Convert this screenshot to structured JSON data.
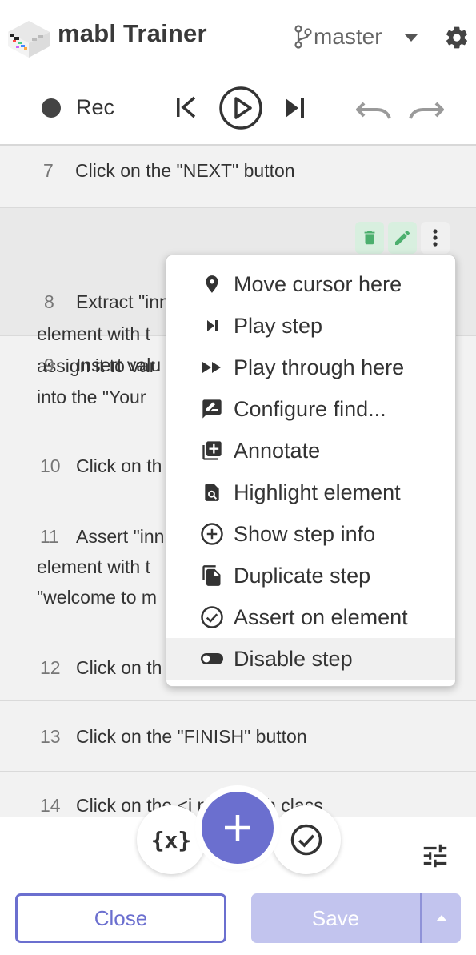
{
  "header": {
    "app_title": "mabl Trainer",
    "branch": "master",
    "branch_icon": "git-branch-icon",
    "settings_icon": "gear-icon"
  },
  "recorder": {
    "rec_label": "Rec",
    "controls": [
      "skip-back-icon",
      "play-icon",
      "skip-forward-icon",
      "undo-icon",
      "redo-icon"
    ]
  },
  "steps": [
    {
      "num": "7",
      "text": "Click on the \"NEXT\" button"
    },
    {
      "num": "8",
      "line1": "Extract \"innerText\" from the <h",
      "line2": "element with t",
      "line3": "assign it to var"
    },
    {
      "num": "9",
      "line1": "Insert valu",
      "line2": "into the \"Your"
    },
    {
      "num": "10",
      "text": "Click on th"
    },
    {
      "num": "11",
      "line1": "Assert \"inn",
      "line2": "element with t",
      "line3": "\"welcome to m"
    },
    {
      "num": "12",
      "text": "Click on th"
    },
    {
      "num": "13",
      "text": "Click on the \"FINISH\" button"
    },
    {
      "num": "14",
      "text": "Click on the <i    ment with class"
    }
  ],
  "context_menu": [
    {
      "label": "Move cursor here",
      "icon": "location-pin-icon"
    },
    {
      "label": "Play step",
      "icon": "play-step-icon"
    },
    {
      "label": "Play through here",
      "icon": "fast-forward-icon"
    },
    {
      "label": "Configure find...",
      "icon": "configure-find-icon"
    },
    {
      "label": "Annotate",
      "icon": "annotate-icon"
    },
    {
      "label": "Highlight element",
      "icon": "highlight-element-icon"
    },
    {
      "label": "Show step info",
      "icon": "add-circle-icon"
    },
    {
      "label": "Duplicate step",
      "icon": "duplicate-icon"
    },
    {
      "label": "Assert on element",
      "icon": "check-circle-icon"
    },
    {
      "label": "Disable step",
      "icon": "toggle-icon"
    }
  ],
  "actions": {
    "variables_label": "{x}",
    "add_icon": "plus-icon",
    "assert_icon": "check-circle-icon",
    "tune_icon": "tune-icon"
  },
  "footer": {
    "close_label": "Close",
    "save_label": "Save"
  },
  "colors": {
    "accent": "#6b6fcf",
    "accent_disabled": "#c2c4ee",
    "tool_green": "#4caf6e"
  }
}
